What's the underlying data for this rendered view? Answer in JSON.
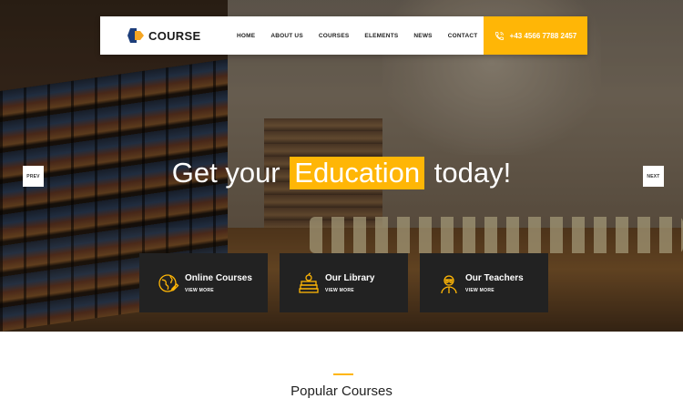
{
  "brand": {
    "name": "COURSE"
  },
  "nav": {
    "items": [
      "HOME",
      "ABOUT US",
      "COURSES",
      "ELEMENTS",
      "NEWS",
      "CONTACT"
    ],
    "phone": "+43 4566 7788 2457"
  },
  "hero": {
    "headline_before": "Get your",
    "headline_highlight": "Education",
    "headline_after": "today!",
    "prev_label": "PREV",
    "next_label": "NEXT"
  },
  "features": [
    {
      "title": "Online Courses",
      "link": "VIEW MORE",
      "icon": "globe-pen-icon"
    },
    {
      "title": "Our Library",
      "link": "VIEW MORE",
      "icon": "books-apple-icon"
    },
    {
      "title": "Our Teachers",
      "link": "VIEW MORE",
      "icon": "teacher-icon"
    }
  ],
  "section": {
    "title": "Popular Courses"
  },
  "colors": {
    "accent": "#ffb606",
    "card_bg": "#222222",
    "navy": "#1c3d7a"
  }
}
